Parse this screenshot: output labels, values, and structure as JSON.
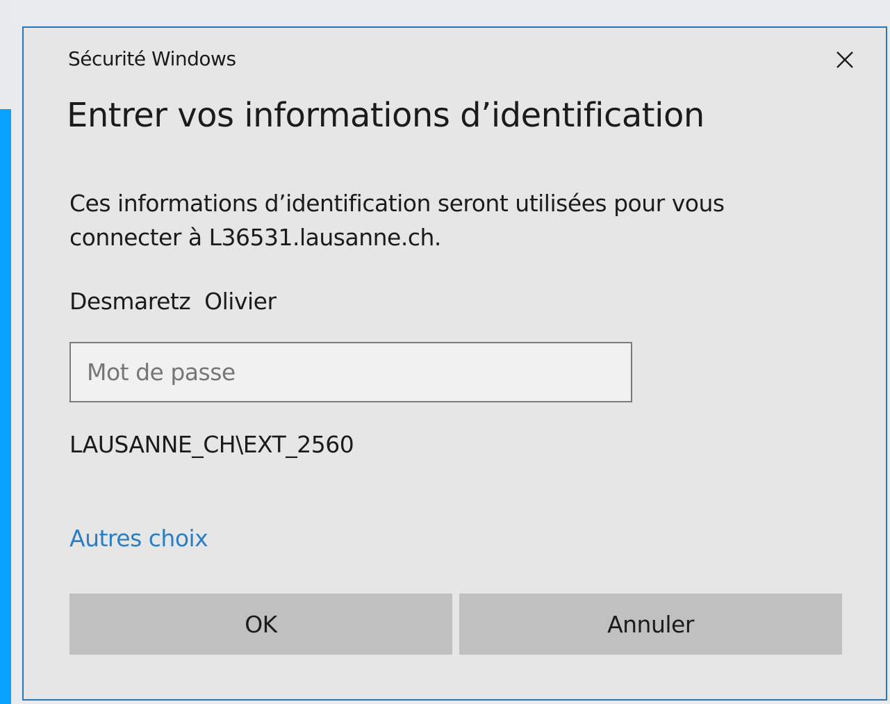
{
  "window": {
    "title": "Sécurité Windows",
    "close_icon": "close-icon"
  },
  "dialog": {
    "heading": "Entrer vos informations d’identification",
    "description": "Ces informations d’identification seront utilisées pour vous connecter à L36531.lausanne.ch.",
    "username": "Desmaretz  Olivier",
    "password": {
      "value": "",
      "placeholder": "Mot de passe"
    },
    "domain": "LAUSANNE_CH\\EXT_2560",
    "more_choices_label": "Autres choix",
    "ok_label": "OK",
    "cancel_label": "Annuler"
  },
  "colors": {
    "accent_strip": "#0aa2ff",
    "dialog_border": "#2b78b7",
    "link": "#2a7fc4",
    "button_bg": "#c0c0c0",
    "dialog_bg": "#e6e6e6"
  }
}
